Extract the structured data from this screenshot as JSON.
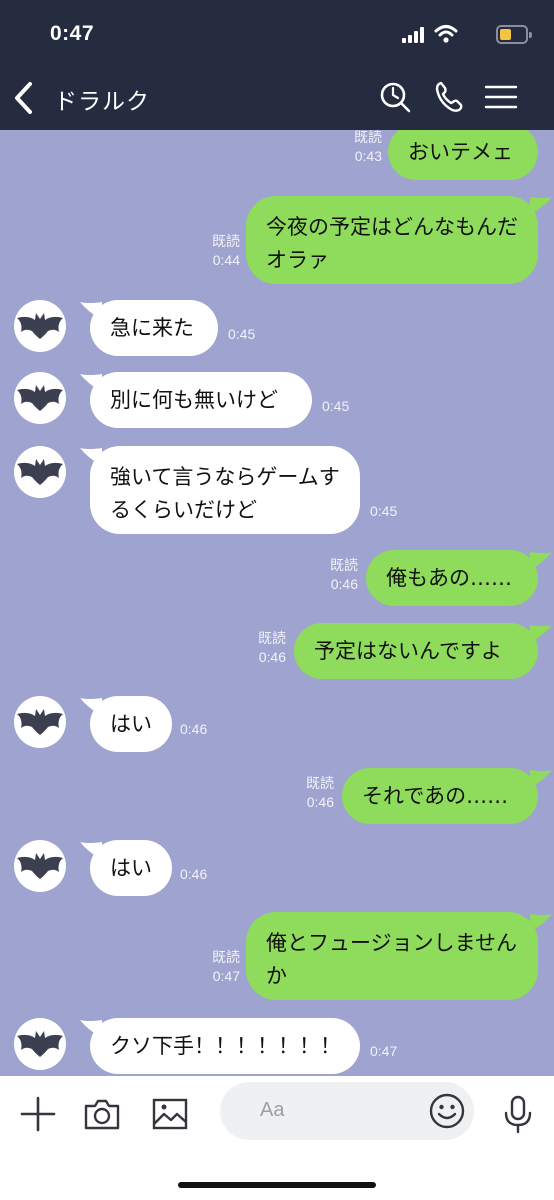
{
  "status_bar": {
    "time": "0:47"
  },
  "header": {
    "title": "ドラルク"
  },
  "messages": [
    {
      "side": "out",
      "text": "おいテメェ",
      "read": "既読",
      "time": "0:43"
    },
    {
      "side": "out",
      "text": "今夜の予定はどんなもんだオラァ",
      "read": "既読",
      "time": "0:44"
    },
    {
      "side": "in",
      "text": "急に来た",
      "time": "0:45"
    },
    {
      "side": "in",
      "text": "別に何も無いけど",
      "time": "0:45"
    },
    {
      "side": "in",
      "text": "強いて言うならゲームするくらいだけど",
      "time": "0:45"
    },
    {
      "side": "out",
      "text": "俺もあの……",
      "read": "既読",
      "time": "0:46"
    },
    {
      "side": "out",
      "text": "予定はないんですよ",
      "read": "既読",
      "time": "0:46"
    },
    {
      "side": "in",
      "text": "はい",
      "time": "0:46"
    },
    {
      "side": "out",
      "text": "それであの……",
      "read": "既読",
      "time": "0:46"
    },
    {
      "side": "in",
      "text": "はい",
      "time": "0:46"
    },
    {
      "side": "out",
      "text": "俺とフュージョンしませんか",
      "read": "既読",
      "time": "0:47"
    },
    {
      "side": "in",
      "text": "クソ下手！！！！！！！",
      "time": "0:47"
    }
  ],
  "input": {
    "placeholder": "Aa"
  },
  "icons": {
    "back": "chevron-left-icon",
    "search": "search-icon",
    "call": "phone-icon",
    "menu": "menu-icon",
    "add": "plus-icon",
    "camera": "camera-icon",
    "image": "image-icon",
    "emoji": "smiley-icon",
    "mic": "microphone-icon",
    "avatar": "bat-icon"
  },
  "colors": {
    "header_bg": "#262c40",
    "chat_bg": "#9ea3cf",
    "outgoing_bubble": "#8fdb5b",
    "incoming_bubble": "#ffffff",
    "battery": "#f5c542"
  }
}
